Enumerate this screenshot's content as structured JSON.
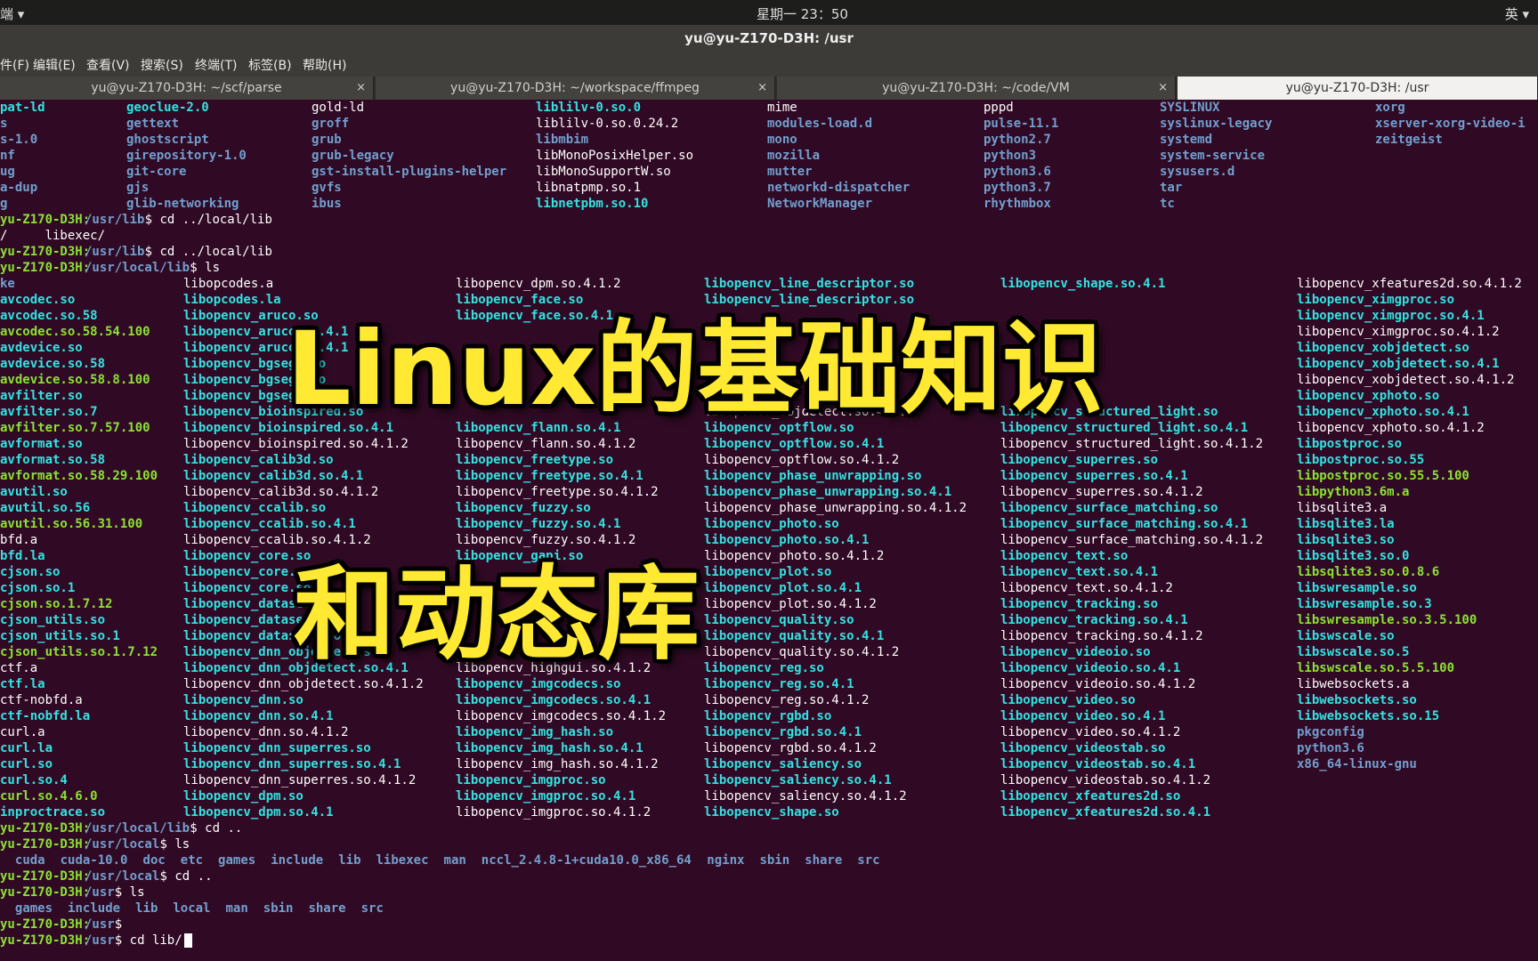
{
  "topbar": {
    "app_menu": "端 ▾",
    "clock": "星期一 23：50",
    "input_method": "英 ▾"
  },
  "window": {
    "title": "yu@yu-Z170-D3H: /usr"
  },
  "menu": [
    "件(F)",
    "编辑(E)",
    "查看(V)",
    "搜索(S)",
    "终端(T)",
    "标签(B)",
    "帮助(H)"
  ],
  "tabs": [
    {
      "label": "yu@yu-Z170-D3H: ~/scf/parse"
    },
    {
      "label": "yu@yu-Z170-D3H: ~/workspace/ffmpeg"
    },
    {
      "label": "yu@yu-Z170-D3H: ~/code/VM"
    },
    {
      "label": "yu@yu-Z170-D3H: /usr"
    }
  ],
  "overlay": {
    "line1": "Linux的基础知识",
    "line2": "和动态库"
  },
  "terminal": {
    "block1": [
      [
        "pat-ld",
        "geoclue-2.0",
        "gold-ld",
        "liblilv-0.so.0",
        "mime",
        "pppd",
        "SYSLINUX",
        "xorg"
      ],
      [
        "s",
        "gettext",
        "groff",
        "liblilv-0.so.0.24.2",
        "modules-load.d",
        "pulse-11.1",
        "syslinux-legacy",
        "xserver-xorg-video-i"
      ],
      [
        "s-1.0",
        "ghostscript",
        "grub",
        "libmbim",
        "mono",
        "python2.7",
        "systemd",
        "zeitgeist"
      ],
      [
        "nf",
        "girepository-1.0",
        "grub-legacy",
        "libMonoPosixHelper.so",
        "mozilla",
        "python3",
        "system-service",
        ""
      ],
      [
        "ug",
        "git-core",
        "gst-install-plugins-helper",
        "libMonoSupportW.so",
        "mutter",
        "python3.6",
        "sysusers.d",
        ""
      ],
      [
        "a-dup",
        "gjs",
        "gvfs",
        "libnatpmp.so.1",
        "networkd-dispatcher",
        "python3.7",
        "tar",
        ""
      ],
      [
        "g",
        "glib-networking",
        "ibus",
        "libnetpbm.so.10",
        "NetworkManager",
        "rhythmbox",
        "tc",
        ""
      ]
    ],
    "prompt_user": "yu-Z170-D3H",
    "lines_mid": [
      {
        "path": "/usr/lib",
        "cmd": "$ cd ../local/lib"
      },
      {
        "plain": "/     libexec/"
      },
      {
        "path": "/usr/lib",
        "cmd": "$ cd ../local/lib"
      },
      {
        "path": "/usr/local/lib",
        "cmd": "$ ls"
      }
    ],
    "col1": [
      "ke",
      "avcodec.so",
      "avcodec.so.58",
      "avcodec.so.58.54.100",
      "avdevice.so",
      "avdevice.so.58",
      "avdevice.so.58.8.100",
      "avfilter.so",
      "avfilter.so.7",
      "avfilter.so.7.57.100",
      "avformat.so",
      "avformat.so.58",
      "avformat.so.58.29.100",
      "avutil.so",
      "avutil.so.56",
      "avutil.so.56.31.100",
      "bfd.a",
      "bfd.la",
      "cjson.so",
      "cjson.so.1",
      "cjson.so.1.7.12",
      "cjson_utils.so",
      "cjson_utils.so.1",
      "cjson_utils.so.1.7.12",
      "ctf.a",
      "ctf.la",
      "ctf-nobfd.a",
      "ctf-nobfd.la",
      "curl.a",
      "curl.la",
      "curl.so",
      "curl.so.4",
      "curl.so.4.6.0",
      "inproctrace.so"
    ],
    "col2": [
      "libopcodes.a",
      "libopcodes.la",
      "libopencv_aruco.so",
      "libopencv_aruco.so.4.1",
      "libopencv_aruco.so.4.1",
      "libopencv_bgsegm.so",
      "libopencv_bgsegm.so",
      "libopencv_bgsegm.so",
      "libopencv_bioinspired.so",
      "libopencv_bioinspired.so.4.1",
      "libopencv_bioinspired.so.4.1.2",
      "libopencv_calib3d.so",
      "libopencv_calib3d.so.4.1",
      "libopencv_calib3d.so.4.1.2",
      "libopencv_ccalib.so",
      "libopencv_ccalib.so.4.1",
      "libopencv_ccalib.so.4.1.2",
      "libopencv_core.so",
      "libopencv_core.so",
      "libopencv_core.so",
      "libopencv_datasets.so",
      "libopencv_datasets.so",
      "libopencv_datasets.so",
      "libopencv_dnn_objdetect.so",
      "libopencv_dnn_objdetect.so.4.1",
      "libopencv_dnn_objdetect.so.4.1.2",
      "libopencv_dnn.so",
      "libopencv_dnn.so.4.1",
      "libopencv_dnn.so.4.1.2",
      "libopencv_dnn_superres.so",
      "libopencv_dnn_superres.so.4.1",
      "libopencv_dnn_superres.so.4.1.2",
      "libopencv_dpm.so",
      "libopencv_dpm.so.4.1"
    ],
    "col3": [
      "libopencv_dpm.so.4.1.2",
      "libopencv_face.so",
      "libopencv_face.so.4.1",
      "",
      "",
      "",
      "",
      "",
      "",
      "libopencv_flann.so.4.1",
      "libopencv_flann.so.4.1.2",
      "libopencv_freetype.so",
      "libopencv_freetype.so.4.1",
      "libopencv_freetype.so.4.1.2",
      "libopencv_fuzzy.so",
      "libopencv_fuzzy.so.4.1",
      "libopencv_fuzzy.so.4.1.2",
      "libopencv_gapi.so",
      "",
      "",
      "",
      "",
      "",
      "",
      "libopencv_highgui.so.4.1.2",
      "libopencv_imgcodecs.so",
      "libopencv_imgcodecs.so.4.1",
      "libopencv_imgcodecs.so.4.1.2",
      "libopencv_img_hash.so",
      "libopencv_img_hash.so.4.1",
      "libopencv_img_hash.so.4.1.2",
      "libopencv_imgproc.so",
      "libopencv_imgproc.so.4.1",
      "libopencv_imgproc.so.4.1.2"
    ],
    "col4": [
      "libopencv_line_descriptor.so",
      "libopencv_line_descriptor.so",
      "",
      "",
      "",
      "",
      "",
      "",
      "libopencv_objdetect.so.4.1.2",
      "libopencv_optflow.so",
      "libopencv_optflow.so.4.1",
      "libopencv_optflow.so.4.1.2",
      "libopencv_phase_unwrapping.so",
      "libopencv_phase_unwrapping.so.4.1",
      "libopencv_phase_unwrapping.so.4.1.2",
      "libopencv_photo.so",
      "libopencv_photo.so.4.1",
      "libopencv_photo.so.4.1.2",
      "libopencv_plot.so",
      "libopencv_plot.so.4.1",
      "libopencv_plot.so.4.1.2",
      "libopencv_quality.so",
      "libopencv_quality.so.4.1",
      "libopencv_quality.so.4.1.2",
      "libopencv_reg.so",
      "libopencv_reg.so.4.1",
      "libopencv_reg.so.4.1.2",
      "libopencv_rgbd.so",
      "libopencv_rgbd.so.4.1",
      "libopencv_rgbd.so.4.1.2",
      "libopencv_saliency.so",
      "libopencv_saliency.so.4.1",
      "libopencv_saliency.so.4.1.2",
      "libopencv_shape.so"
    ],
    "col5": [
      "libopencv_shape.so.4.1",
      "",
      "",
      "",
      "",
      "",
      "",
      "",
      "libopencv_structured_light.so",
      "libopencv_structured_light.so.4.1",
      "libopencv_structured_light.so.4.1.2",
      "libopencv_superres.so",
      "libopencv_superres.so.4.1",
      "libopencv_superres.so.4.1.2",
      "libopencv_surface_matching.so",
      "libopencv_surface_matching.so.4.1",
      "libopencv_surface_matching.so.4.1.2",
      "libopencv_text.so",
      "libopencv_text.so.4.1",
      "libopencv_text.so.4.1.2",
      "libopencv_tracking.so",
      "libopencv_tracking.so.4.1",
      "libopencv_tracking.so.4.1.2",
      "libopencv_videoio.so",
      "libopencv_videoio.so.4.1",
      "libopencv_videoio.so.4.1.2",
      "libopencv_video.so",
      "libopencv_video.so.4.1",
      "libopencv_video.so.4.1.2",
      "libopencv_videostab.so",
      "libopencv_videostab.so.4.1",
      "libopencv_videostab.so.4.1.2",
      "libopencv_xfeatures2d.so",
      "libopencv_xfeatures2d.so.4.1"
    ],
    "col6": [
      "libopencv_xfeatures2d.so.4.1.2",
      "libopencv_ximgproc.so",
      "libopencv_ximgproc.so.4.1",
      "libopencv_ximgproc.so.4.1.2",
      "libopencv_xobjdetect.so",
      "libopencv_xobjdetect.so.4.1",
      "libopencv_xobjdetect.so.4.1.2",
      "libopencv_xphoto.so",
      "libopencv_xphoto.so.4.1",
      "libopencv_xphoto.so.4.1.2",
      "libpostproc.so",
      "libpostproc.so.55",
      "libpostproc.so.55.5.100",
      "libpython3.6m.a",
      "libsqlite3.a",
      "libsqlite3.la",
      "libsqlite3.so",
      "libsqlite3.so.0",
      "libsqlite3.so.0.8.6",
      "libswresample.so",
      "libswresample.so.3",
      "libswresample.so.3.5.100",
      "libswscale.so",
      "libswscale.so.5",
      "libswscale.so.5.5.100",
      "libwebsockets.a",
      "libwebsockets.so",
      "libwebsockets.so.15",
      "pkgconfig",
      "python3.6",
      "x86_64-linux-gnu",
      "",
      "",
      ""
    ],
    "tail": [
      {
        "path": "/usr/local/lib",
        "cmd": "$ cd .."
      },
      {
        "path": "/usr/local",
        "cmd": "$ ls"
      },
      {
        "ls": "  cuda  cuda-10.0  doc  etc  games  include  lib  libexec  man  nccl_2.4.8-1+cuda10.0_x86_64  nginx  sbin  share  src"
      },
      {
        "path": "/usr/local",
        "cmd": "$ cd .."
      },
      {
        "path": "/usr",
        "cmd": "$ ls"
      },
      {
        "ls": "  games  include  lib  local  man  sbin  share  src"
      },
      {
        "path": "/usr",
        "cmd": "$"
      },
      {
        "path": "/usr",
        "cmd": "$ cd lib/"
      }
    ]
  }
}
